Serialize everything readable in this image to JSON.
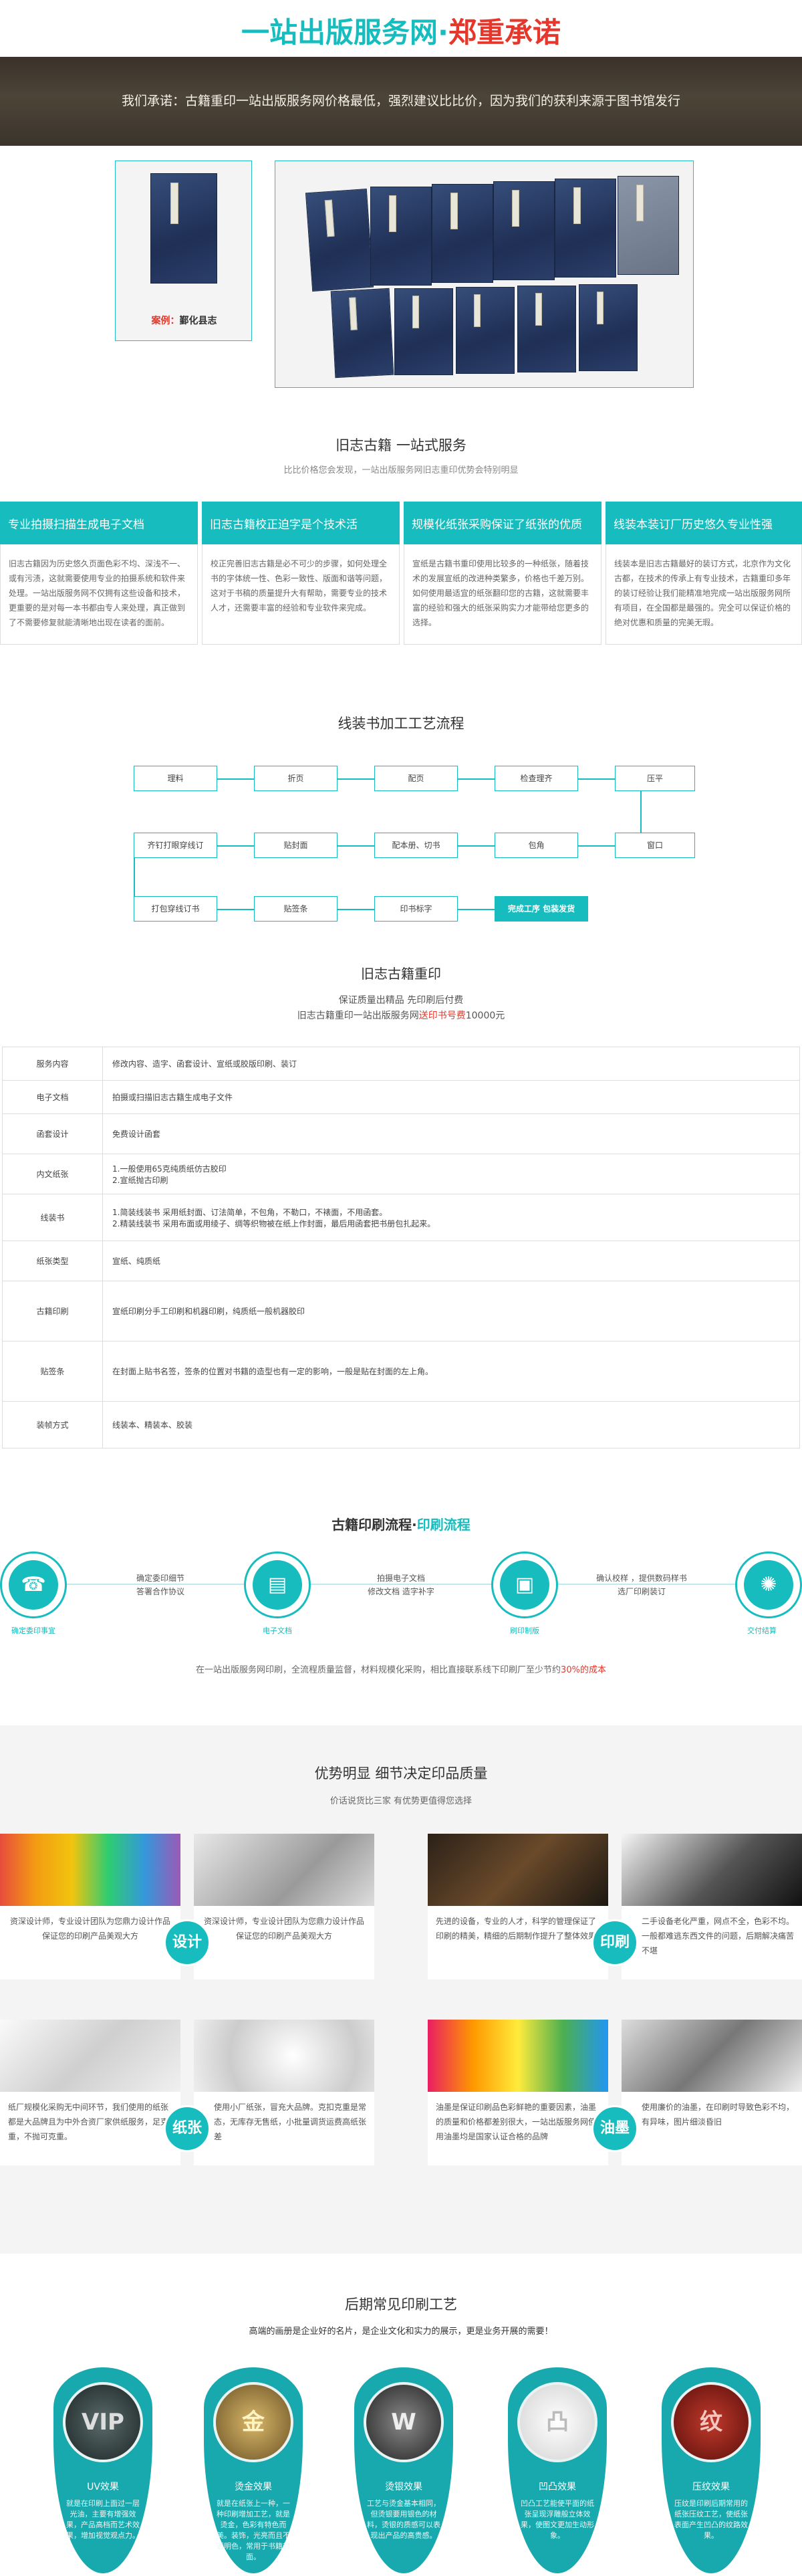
{
  "header": {
    "brand_title": "一站出版服务网",
    "dot": "·",
    "promise_word": "郑重承诺",
    "promise_text": "我们承诺：古籍重印一站出版服务网价格最低，强烈建议比比价，因为我们的获利来源于图书馆发行"
  },
  "case_photo": {
    "caption_red": "案例：",
    "caption_black": "鄞化县志"
  },
  "intro": {
    "title": "旧志古籍  一站式服务",
    "subtitle": "比比价格您会发现，一站出版服务网旧志重印优势会特别明显"
  },
  "features": [
    {
      "title": "专业拍摄扫描生成电子文档",
      "text": "旧志古籍因为历史悠久页面色彩不均、深浅不一、或有污渍，这就需要使用专业的拍摄系统和软件来处理。一站出版服务网不仅拥有这些设备和技术，更重要的是对每一本书都由专人来处理，真正做到了不需要修复就能清晰地出现在读者的面前。"
    },
    {
      "title": "旧志古籍校正迫字是个技术活",
      "text": "校正完善旧志古籍是必不可少的步骤，如何处理全书的字体统一性、色彩一致性、版面和谐等问题，这对于书稿的质量提升大有帮助，需要专业的技术人才，还需要丰富的经验和专业软件来完成。"
    },
    {
      "title": "规模化纸张采购保证了纸张的优质",
      "text": "宣纸是古籍书重印使用比较多的一种纸张，随着技术的发展宣纸的改进种类繁多，价格也千差万别。如何使用最适宜的纸张翻印您的古籍，这就需要丰富的经验和强大的纸张采购实力才能带给您更多的选择。"
    },
    {
      "title": "线装本装订厂历史悠久专业性强",
      "text": "线装本是旧志古籍最好的装订方式，北京作为文化古都，在技术的传承上有专业技术，古籍重印多年的装订经验让我们能精准地完成一站出版服务网所有项目，在全国都是最强的。完全可以保证价格的绝对优惠和质量的完美无瑕。"
    }
  ],
  "process": {
    "title": "线装书加工工艺流程",
    "row1": [
      "理料",
      "折页",
      "配页",
      "检查理齐",
      "压平"
    ],
    "row2": [
      "齐钉打眼穿线订",
      "贴封面",
      "配本册、切书",
      "包角",
      "窗口"
    ],
    "row3": [
      "打包穿线订书",
      "贴签条",
      "印书标字",
      "完成工序  包装发货"
    ]
  },
  "pricing": {
    "title": "旧志古籍重印",
    "line1": "保证质量出精品   先印刷后付费",
    "line2_pre": "旧志古籍重印一站出版服务网",
    "line2_red": "送印书号费",
    "line2_post": "10000元"
  },
  "service_table": [
    {
      "k": "服务内容",
      "v": [
        "修改内容、造字、函套设计、宣纸或胶版印刷、装订"
      ]
    },
    {
      "k": "电子文档",
      "v": [
        "拍摄或扫描旧志古籍生成电子文件"
      ]
    },
    {
      "k": "函套设计",
      "v": [
        "免费设计函套"
      ]
    },
    {
      "k": "内文纸张",
      "v": [
        "1.一般使用65克纯质纸仿古胶印",
        "2.宣纸抛古印刷"
      ]
    },
    {
      "k": "线装书",
      "v": [
        "1.简装线装书  采用纸封面、订法简单，不包角，不勒口，不裱面，不用函套。",
        "2.精装线装书  采用布面或用绫子、绸等织物被在纸上作封面，最后用函套把书册包扎起来。"
      ]
    },
    {
      "k": "纸张类型",
      "v": [
        "宣纸、纯质纸"
      ]
    },
    {
      "k": "古籍印刷",
      "v": [
        "宣纸印刷分手工印刷和机器印刷，纯质纸一般机器胶印"
      ]
    },
    {
      "k": "贴签条",
      "v": [
        "在封面上贴书名签，签条的位置对书籍的造型也有一定的影响，一般是贴在封面的左上角。"
      ]
    },
    {
      "k": "装帧方式",
      "v": [
        "线装本、精装本、胶装"
      ]
    }
  ],
  "print_flow": {
    "title_black": "古籍印刷流程·",
    "title_teal": "印刷流程",
    "steps": [
      {
        "icon": "phone-icon",
        "label": "确定委印事宜",
        "desc": ""
      },
      {
        "icon": "document-icon",
        "label": "电子文档",
        "desc": "确定委印细节\n答署合作协议"
      },
      {
        "icon": "id-card-icon",
        "label": "刷印制版",
        "desc": "拍摄电子文档\n修改文档  造字补字"
      },
      {
        "icon": "bulb-icon",
        "label": "交付结算",
        "desc": "确认校样  ，提供数码样书\n选厂印刷装订"
      }
    ],
    "note_pre": "在一站出版服务网印刷，全流程质量监督，材料规模化采购，相比直接联系线下印刷厂至少节约",
    "note_red": "30%的成本"
  },
  "quality": {
    "title": "优势明显  细节决定印品质量",
    "subtitle": "价话说货比三家  有优势更值得您选择",
    "blocks": [
      {
        "badge": "设计",
        "left_text": "资深设计师，专业设计团队为您鼎力设计作品保证您的印刷产品美观大方",
        "right_text": "资深设计师，专业设计团队为您鼎力设计作品保证您的印刷产品美观大方"
      },
      {
        "badge": "印刷",
        "left_text": "先进的设备，专业的人才，科学的管理保证了印刷的精美，精细的后期制作提升了整体效果",
        "right_text": "二手设备老化严重，网点不全，色彩不均。一般都难逃东西文件的问题，后期解决痛苦不堪"
      },
      {
        "badge": "纸张",
        "left_text": "纸厂规模化采购无中间环节，我们使用的纸张都是大品牌且为中外合资厂家供纸服务，足克重，不抛可克重。",
        "right_text": "使用小厂纸张，冒充大品牌。克扣克重是常态，无库存无售纸，小批量调货运费高纸张差"
      },
      {
        "badge": "油墨",
        "left_text": "油墨是保证印刷品色彩鲜艳的重要因素，油墨的质量和价格都差别很大，一站出版服务网使用油墨均是国家认证合格的品牌",
        "right_text": "使用廉价的油墨，在印刷时导致色彩不均，有异味，图片细淡昏旧"
      }
    ]
  },
  "crafts": {
    "title": "后期常见印刷工艺",
    "subtitle": "高端的画册是企业好的名片，是企业文化和实力的展示，更是业务开展的需要！",
    "items": [
      {
        "name": "UV效果",
        "desc": "就是在印刷上面过一层光油，主要有增强效果，产品高档而艺术效果，增加视觉观点力。",
        "mark": "VIP"
      },
      {
        "name": "烫金效果",
        "desc": "就是在纸张上一种，一种印刷增加工艺，就是烫金，色彩有特色而美。装饰，光亮而且不透明色，常用于书籍封面。",
        "mark": "金"
      },
      {
        "name": "烫银效果",
        "desc": "工艺与烫金基本相同，但烫银要用银色的材料，烫银的质感可以表现出产品的高贵感。",
        "mark": "W"
      },
      {
        "name": "凹凸效果",
        "desc": "凹凸工艺能使平面的纸张呈现浮雕般立体效果，使图文更加生动形象。",
        "mark": "凸"
      },
      {
        "name": "压纹效果",
        "desc": "压纹是印刷后期常用的纸张压纹工艺，使纸张表面产生凹凸的纹路效果。",
        "mark": "纹"
      }
    ]
  },
  "colors": {
    "teal": "#17bdbe",
    "red": "#e5372b",
    "dark_banner": "#3d352c"
  }
}
